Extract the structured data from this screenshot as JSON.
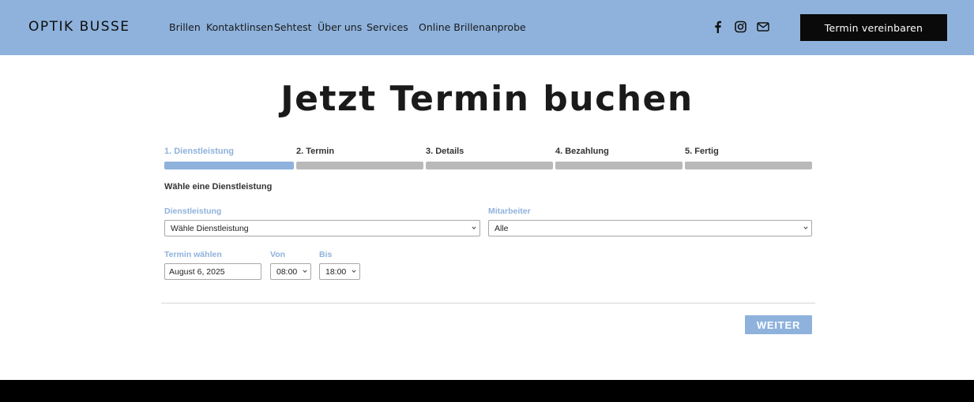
{
  "header": {
    "logo": "OPTIK BUSSE",
    "nav": [
      "Brillen",
      "Kontaktlinsen",
      "Sehtest",
      "Über uns",
      "Services",
      "Online Brillenanprobe"
    ],
    "social_icons": [
      "facebook-icon",
      "instagram-icon",
      "mail-icon"
    ],
    "cta_label": "Termin vereinbaren"
  },
  "page_title": "Jetzt Termin buchen",
  "steps": [
    "1. Dienstleistung",
    "2. Termin",
    "3. Details",
    "4. Bezahlung",
    "5. Fertig"
  ],
  "active_step": 1,
  "form": {
    "heading": "Wähle eine Dienstleistung",
    "service_label": "Dienstleistung",
    "service_value": "Wähle Dienstleistung",
    "staff_label": "Mitarbeiter",
    "staff_value": "Alle",
    "date_label": "Termin wählen",
    "date_value": "August 6, 2025",
    "from_label": "Von",
    "from_value": "08:00",
    "to_label": "Bis",
    "to_value": "18:00",
    "next_label": "WEITER"
  },
  "colors": {
    "accent": "#8eb2dc",
    "header_bg": "#8eb2dc",
    "cta_bg": "#0a0a0a",
    "inactive_bar": "#b9b9b9",
    "footer_bg": "#000000"
  }
}
